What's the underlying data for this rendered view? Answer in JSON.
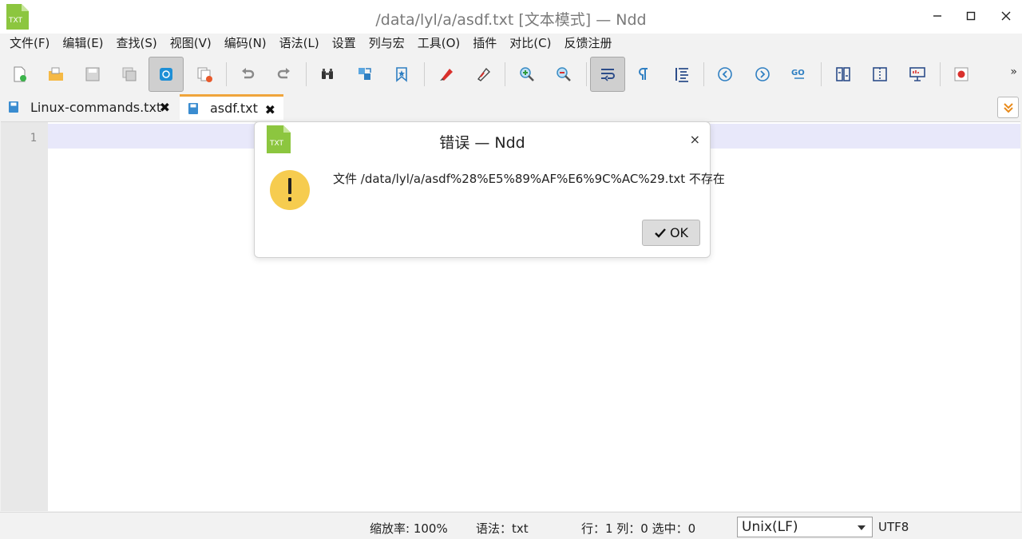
{
  "window": {
    "title": "/data/lyl/a/asdf.txt [文本模式] — Ndd",
    "app_icon_text": "TXT",
    "icons": [
      "minimize-icon",
      "maximize-icon",
      "close-icon"
    ]
  },
  "menu": [
    "文件(F)",
    "编辑(E)",
    "查找(S)",
    "视图(V)",
    "编码(N)",
    "语法(L)",
    "设置",
    "列与宏",
    "工具(O)",
    "插件",
    "对比(C)",
    "反馈注册"
  ],
  "toolbar": {
    "more_label": "»",
    "buttons": [
      "new-file-icon",
      "open-file-icon",
      "save-icon",
      "save-all-icon",
      "auto-save-icon",
      "close-file-icon",
      "undo-icon",
      "redo-icon",
      "find-icon",
      "replace-icon",
      "bookmark-icon",
      "mark-icon",
      "clear-mark-icon",
      "zoom-in-icon",
      "zoom-out-icon",
      "word-wrap-icon",
      "show-symbols-icon",
      "indent-guide-icon",
      "prev-icon",
      "next-icon",
      "goto-icon",
      "compare-icon",
      "split-view-icon",
      "presentation-icon",
      "record-macro-icon"
    ]
  },
  "tabs": [
    {
      "label": "Linux-commands.txt",
      "close": "✖"
    },
    {
      "label": "asdf.txt",
      "close": "✖"
    }
  ],
  "editor": {
    "line_numbers": [
      "1"
    ]
  },
  "statusbar": {
    "zoom": "缩放率: 100%",
    "syntax": "语法：txt",
    "position": "行：1 列：0 选中：0",
    "eol": "Unix(LF)",
    "encoding": "UTF8"
  },
  "dialog": {
    "title": "错误 — Ndd",
    "icon_text": "TXT",
    "close": "×",
    "message": "文件 /data/lyl/a/asdf%28%E5%89%AF%E6%9C%AC%29.txt 不存在",
    "ok_label": "OK"
  },
  "colors": {
    "accent_tab": "#f0a53c",
    "warning": "#f6cc4f",
    "txt_icon": "#8cc63f"
  }
}
